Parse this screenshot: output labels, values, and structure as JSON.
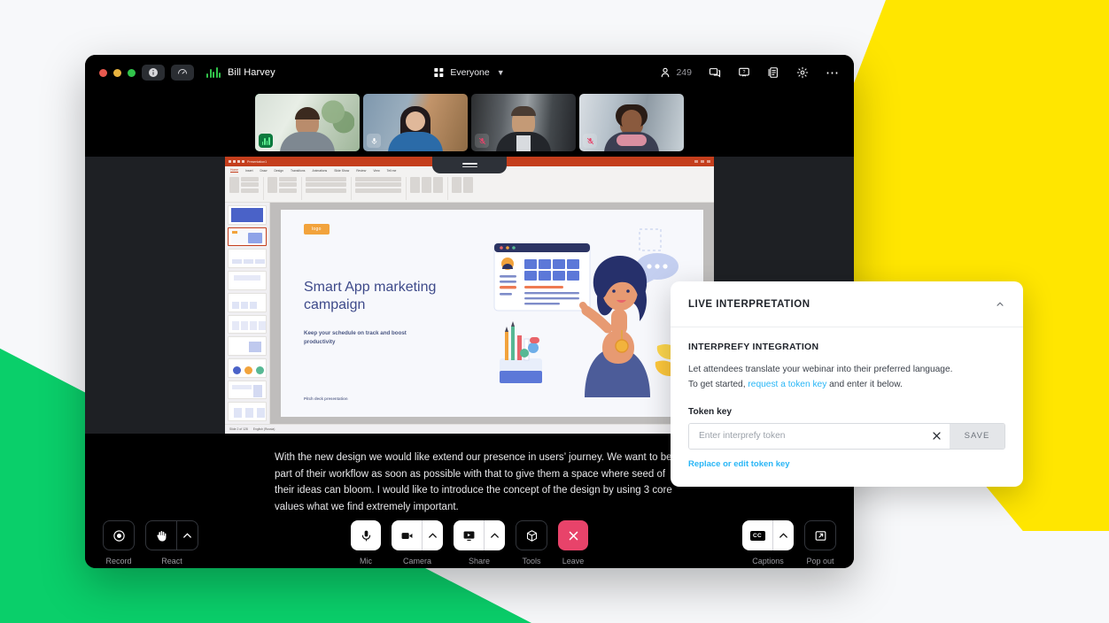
{
  "background": {
    "yellow": "#FFE600",
    "green": "#0ACF6A",
    "page": "#F7F8FA"
  },
  "topbar": {
    "info_icon": "info-icon",
    "gauge_icon": "network-quality-icon",
    "speaking_indicator": "audio-level-icon",
    "host_name": "Bill Harvey",
    "layout_label": "Everyone",
    "layout_chevron": "chevron-down-icon",
    "participant_count": "249",
    "participants_icon": "person-icon",
    "chat_icon": "chat-icon",
    "qa_icon": "question-icon",
    "polls_icon": "polls-icon",
    "settings_icon": "gear-icon",
    "more_icon": "more-dots-icon"
  },
  "participants": [
    {
      "name": "speaker-tile-1",
      "state": "speaking",
      "badge": "audio-level-icon"
    },
    {
      "name": "speaker-tile-2",
      "state": "unmuted",
      "badge": "mic-icon"
    },
    {
      "name": "speaker-tile-3",
      "state": "muted",
      "badge": "mic-muted-icon"
    },
    {
      "name": "speaker-tile-4",
      "state": "muted",
      "badge": "mic-muted-icon"
    }
  ],
  "shared_screen": {
    "app": "powerpoint",
    "drag_handle": "drag-handle",
    "ribbon_tabs": [
      "Home",
      "Insert",
      "Draw",
      "Design",
      "Transitions",
      "Animations",
      "Slide Show",
      "Review",
      "View",
      "Tell me"
    ],
    "selected_tab": "Home",
    "status_left": "Slide 2 of 128",
    "status_right": "English (Russia)",
    "slide": {
      "logo_chip": "logo",
      "title": "Smart App marketing campaign",
      "subtitle": "Keep your schedule on track and boost productivity",
      "footer": "Pitch deck presentation"
    }
  },
  "captions": {
    "text": "With the new design we would like extend our presence in users’ journey. We want to be part of their workflow as soon as possible with that to give them a space where seed of their ideas can bloom. I would like to introduce the concept of the design by using 3 core values what we find extremely important."
  },
  "controls": {
    "left": [
      {
        "label": "Record",
        "icon": "record-icon",
        "style": "dark",
        "split": false
      },
      {
        "label": "React",
        "icon": "raised-hand-icon",
        "style": "dark",
        "split": true
      }
    ],
    "center": [
      {
        "label": "Mic",
        "icon": "mic-icon",
        "style": "light",
        "split": false
      },
      {
        "label": "Camera",
        "icon": "camera-icon",
        "style": "light",
        "split": true
      },
      {
        "label": "Share",
        "icon": "share-screen-icon",
        "style": "light",
        "split": true
      },
      {
        "label": "Tools",
        "icon": "cube-icon",
        "style": "dark",
        "split": false
      },
      {
        "label": "Leave",
        "icon": "close-x-icon",
        "style": "danger",
        "split": false
      }
    ],
    "right": [
      {
        "label": "Captions",
        "icon": "cc-icon",
        "style": "light",
        "split": true
      },
      {
        "label": "Pop out",
        "icon": "pop-out-icon",
        "style": "dark",
        "split": false
      }
    ],
    "split_icon": "chevron-up-icon",
    "leave_color": "#E8436A"
  },
  "panel": {
    "title": "LIVE INTERPRETATION",
    "collapse_icon": "chevron-up-icon",
    "section_title": "INTERPREFY INTEGRATION",
    "desc_line1": "Let attendees translate your webinar into their preferred language.",
    "desc_line2_pre": "To get started, ",
    "desc_link": "request a token key",
    "desc_line2_post": " and enter it below.",
    "field_label": "Token key",
    "input_placeholder": "Enter interprefy token",
    "input_value": "",
    "clear_icon": "close-x-icon",
    "save_label": "SAVE",
    "replace_link": "Replace or edit token key",
    "link_color": "#29B6F6"
  }
}
